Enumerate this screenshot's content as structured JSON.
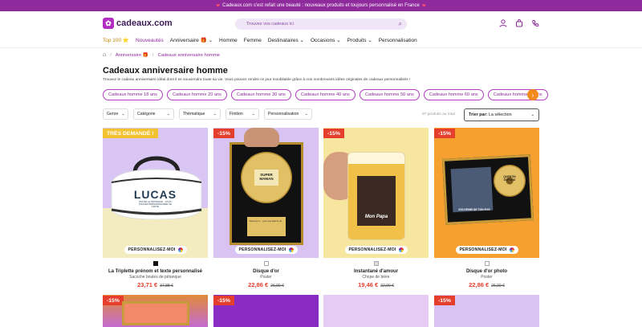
{
  "topbar": {
    "heart_left": "❤",
    "text": "Cadeaux.com s'est refait une beauté : nouveaux produits et toujours personnalisé en France",
    "heart_right": "❤"
  },
  "header": {
    "logo_text": "cadeaux.com",
    "search_placeholder": "Trouvez vos cadeaux ici"
  },
  "nav": {
    "items": [
      "Top 100 ⭐",
      "Nouveautés",
      "Anniversaire 🎁 ⌄",
      "Homme",
      "Femme",
      "Destinataires ⌄",
      "Occasions ⌄",
      "Produits ⌄",
      "Personnalisation"
    ]
  },
  "breadcrumb": {
    "home": "⌂",
    "items": [
      "Anniversaire 🎁",
      "Cadeaux anniversaire homme"
    ]
  },
  "page": {
    "title": "Cadeaux anniversaire homme",
    "intro": "Trouvez le cadeau anniversaire idéal dont il se souviendra toute sa vie. Vous pouvez rendre ce jour inoubliable grâce à nos nombreuses idées originales de cadeaux personnalisés !"
  },
  "chips": [
    "Cadeaux homme 18 ans",
    "Cadeaux homme 20 ans",
    "Cadeaux homme 30 ans",
    "Cadeaux homme 40 ans",
    "Cadeaux homme 50 ans",
    "Cadeaux homme 60 ans",
    "Cadeaux homme 70 ans"
  ],
  "filters": [
    "Genre",
    "Catégorie",
    "Thématique",
    "Finition",
    "Personnalisation"
  ],
  "results": {
    "count": "97 produits au total",
    "sort_label": "Trier par:",
    "sort_value": "La sélection"
  },
  "products": [
    {
      "badge": "TRÈS DEMANDÉ !",
      "perso": "PERSONNALISEZ-MOI",
      "name": "La Triplette prénom et texte personnalisé",
      "sub": "Sacoche boules de pétanque",
      "price": "23,71 €",
      "old": "37,88 €",
      "img_text": "LUCAS",
      "img_sub": "ROI DE LA PÉTANQUE · VOUS POUVEZ PERSONNALISER CE TEXTE"
    },
    {
      "badge": "-15%",
      "perso": "PERSONNALISEZ-MOI",
      "name": "Disque d'or",
      "sub": "Poster",
      "price": "22,86 €",
      "old": "26,90 €",
      "img_text": "SUPER MAMAN",
      "img_sub": "Décerné à ... pour ses talents de..."
    },
    {
      "badge": "-15%",
      "perso": "PERSONNALISEZ-MOI",
      "name": "Instantané d'amour",
      "sub": "Chope de bière",
      "price": "19,46 €",
      "old": "22,90 €",
      "img_text": "Mon Papa"
    },
    {
      "badge": "-15%",
      "perso": "PERSONNALISEZ-MOI",
      "name": "Disque d'or photo",
      "sub": "Poster",
      "price": "22,86 €",
      "old": "26,90 €",
      "img_text": "SOUVENIR DE TON EVG",
      "img_sub": "QUENTIN DUPOND"
    }
  ],
  "row2_badges": [
    "-15%",
    "-15%",
    "-15%"
  ],
  "colors": {
    "brand": "#8e2a9c",
    "accent": "#f28b1c",
    "discount": "#e53e2d"
  }
}
